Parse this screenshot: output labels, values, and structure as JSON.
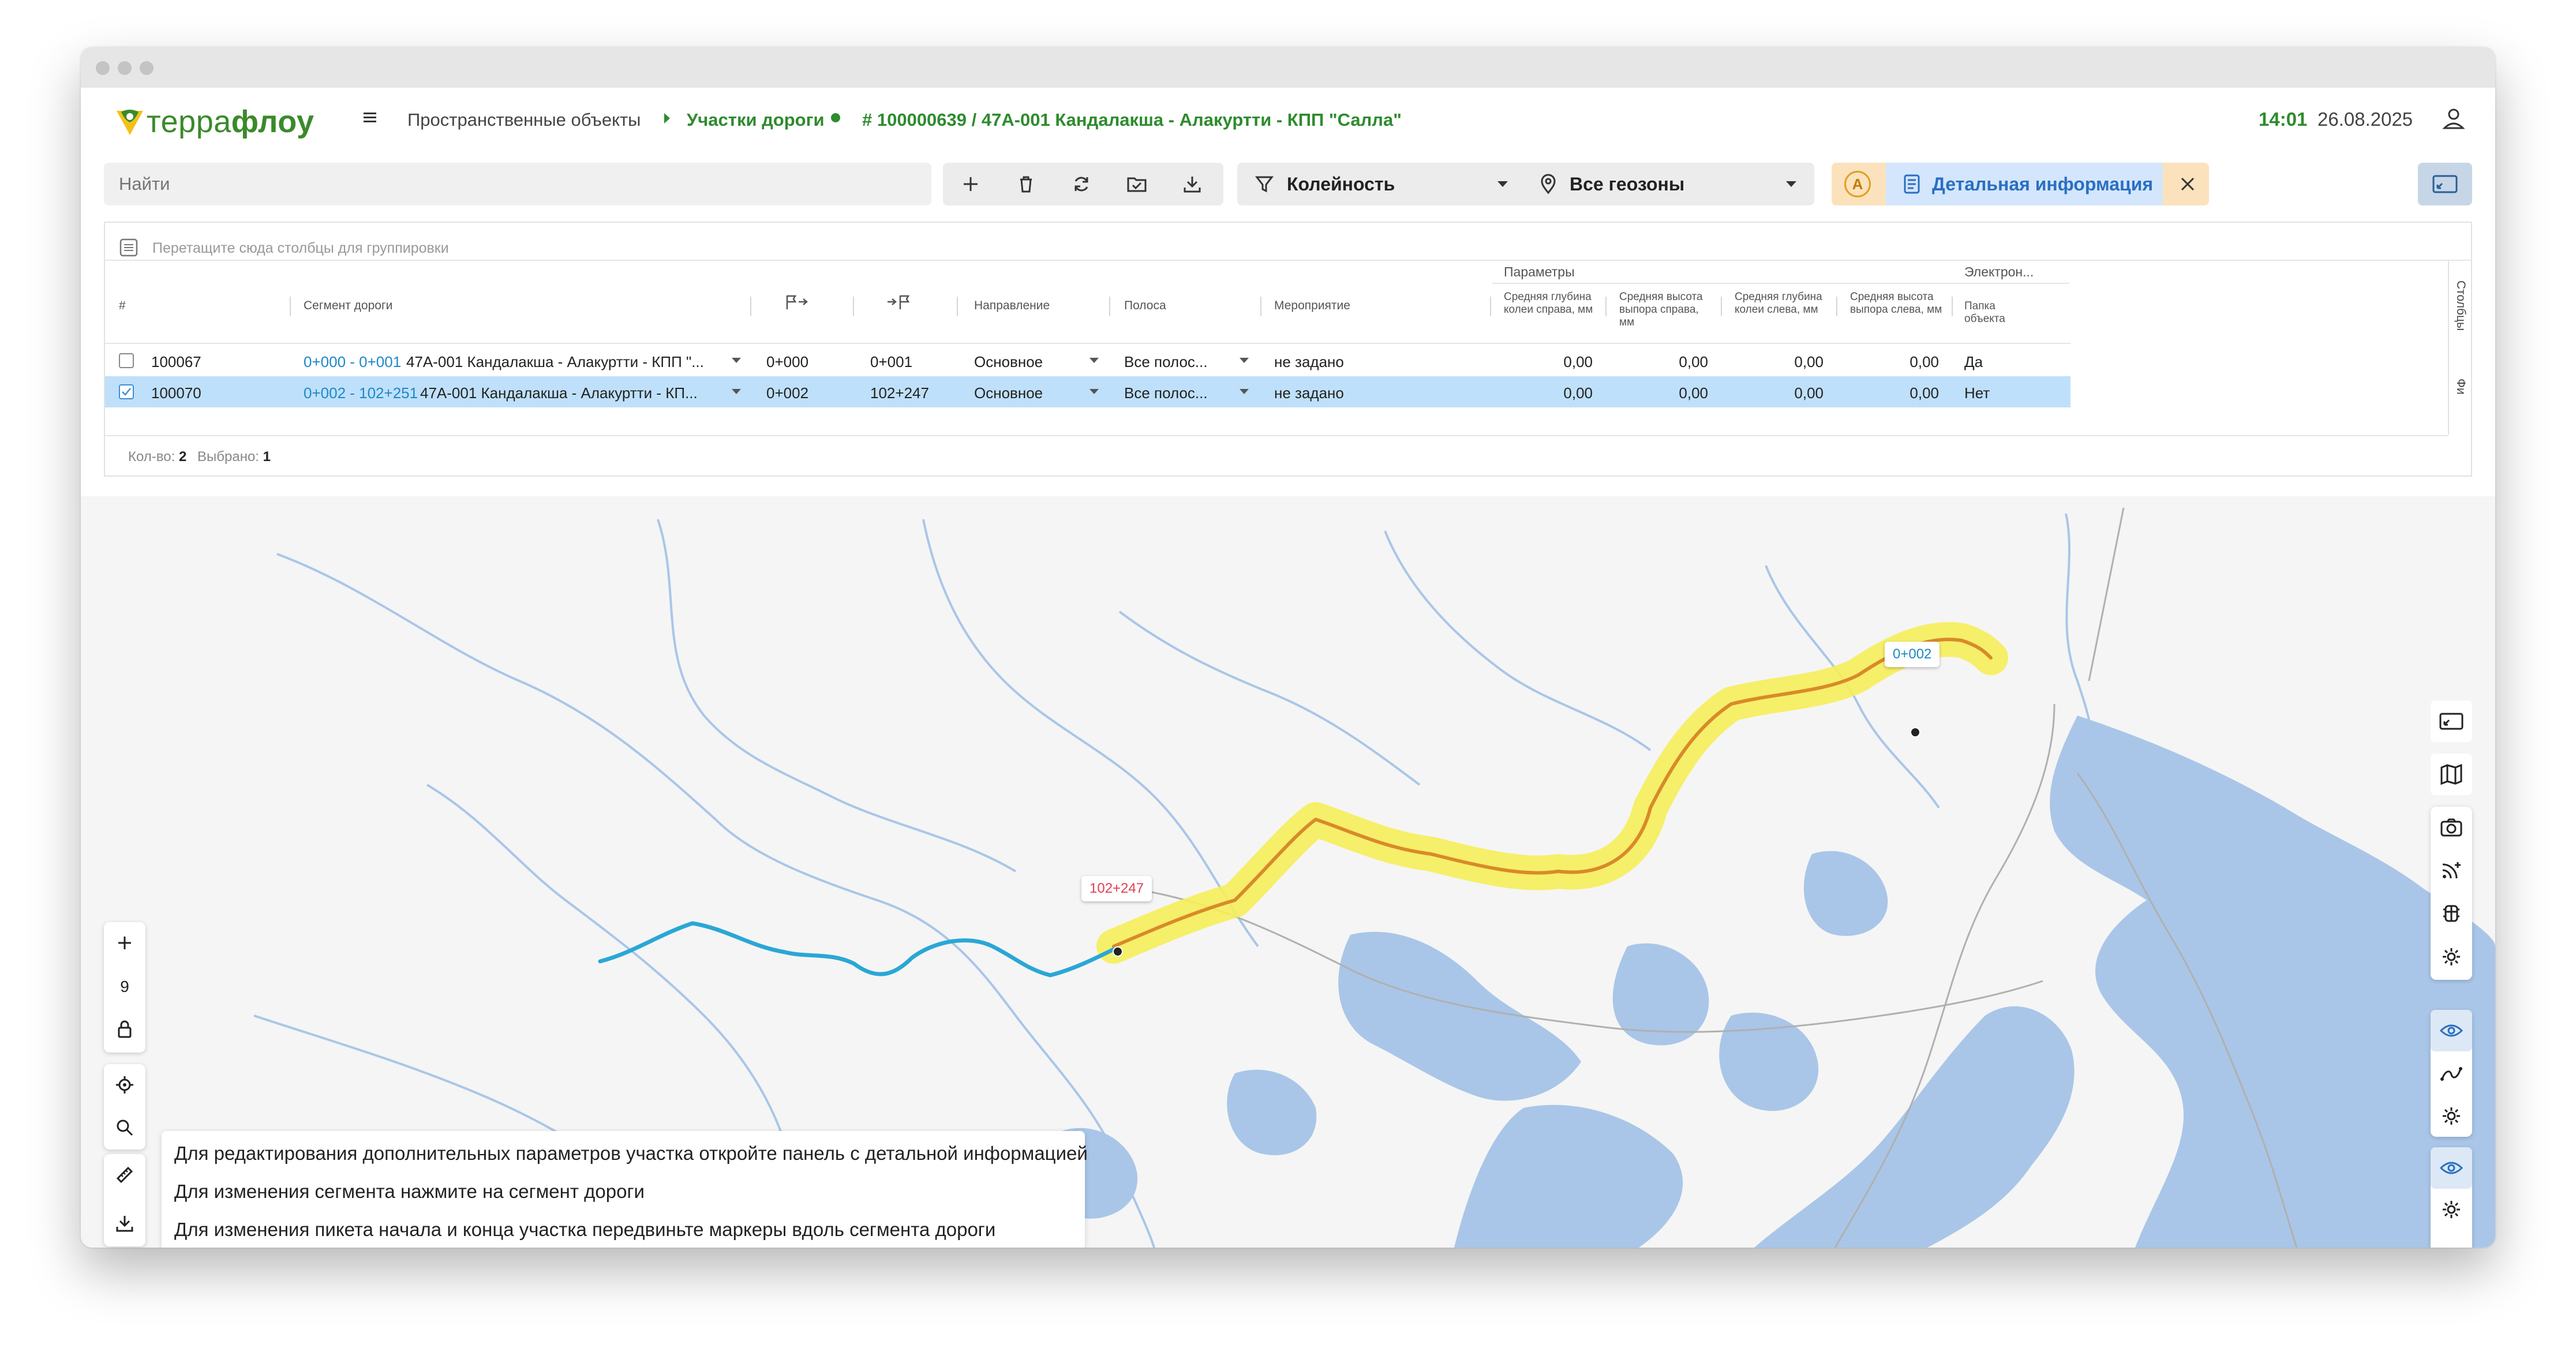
{
  "app": {
    "logo": {
      "prefix": "терра",
      "bold": "флоу"
    },
    "menu_icon": "hamburger-icon"
  },
  "breadcrumb": {
    "item1": "Пространственные объекты",
    "item2": "Участки дороги",
    "item3": "# 100000639 / 47А-001 Кандалакша - Алакуртти - КПП \"Салла\""
  },
  "clock": {
    "time": "14:01",
    "date": "26.08.2025"
  },
  "toolbar": {
    "search_placeholder": "Найти",
    "filter_label": "Колейность",
    "geozone_label": "Все геозоны",
    "detail_badge": "A",
    "detail_label": "Детальная информация"
  },
  "grid": {
    "group_hint": "Перетащите сюда столбцы для группировки",
    "headers": {
      "num": "#",
      "segment": "Сегмент дороги",
      "direction": "Направление",
      "lane": "Полоса",
      "activity": "Мероприятие",
      "params_group": "Параметры",
      "p1": "Средняя глубина колеи справа, мм",
      "p2": "Средняя высота выпора справа, мм",
      "p3": "Средняя глубина колеи слева, мм",
      "p4": "Средняя высота выпора слева, мм",
      "elec_group": "Электрон...",
      "folder": "Папка объекта"
    },
    "side_tabs": {
      "columns": "Столбцы",
      "filters": "Фи"
    },
    "rows": [
      {
        "id": "100067",
        "seg_range": "0+000 - 0+001",
        "seg_name": "47А-001 Кандалакша - Алакуртти - КПП \"...",
        "start": "0+000",
        "end": "0+001",
        "direction": "Основное",
        "lane": "Все полос...",
        "activity": "не задано",
        "p1": "0,00",
        "p2": "0,00",
        "p3": "0,00",
        "p4": "0,00",
        "folder": "Да",
        "selected": false
      },
      {
        "id": "100070",
        "seg_range": "0+002 - 102+251",
        "seg_name": "47А-001 Кандалакша - Алакуртти - КП...",
        "start": "0+002",
        "end": "102+247",
        "direction": "Основное",
        "lane": "Все полос...",
        "activity": "не задано",
        "p1": "0,00",
        "p2": "0,00",
        "p3": "0,00",
        "p4": "0,00",
        "folder": "Нет",
        "selected": true
      }
    ],
    "footer": {
      "count_label": "Кол-во:",
      "count": "2",
      "selected_label": "Выбрано:",
      "selected": "1"
    }
  },
  "map": {
    "marker_start": "0+002",
    "marker_end": "102+247",
    "zoom_level": "9",
    "hints": [
      "Для редактирования дополнительных параметров участка откройте панель с детальной информацией",
      "Для изменения сегмента нажмите на сегмент дороги",
      "Для изменения пикета начала и конца участка передвиньте маркеры вдоль сегмента дороги"
    ]
  },
  "colors": {
    "brand_green": "#2e8b2e",
    "link_blue": "#1e88c8",
    "selection": "#bfe0fa",
    "route_highlight": "#f4ea3a",
    "route_blue": "#2aa7d6",
    "water": "#a9c6e8"
  }
}
